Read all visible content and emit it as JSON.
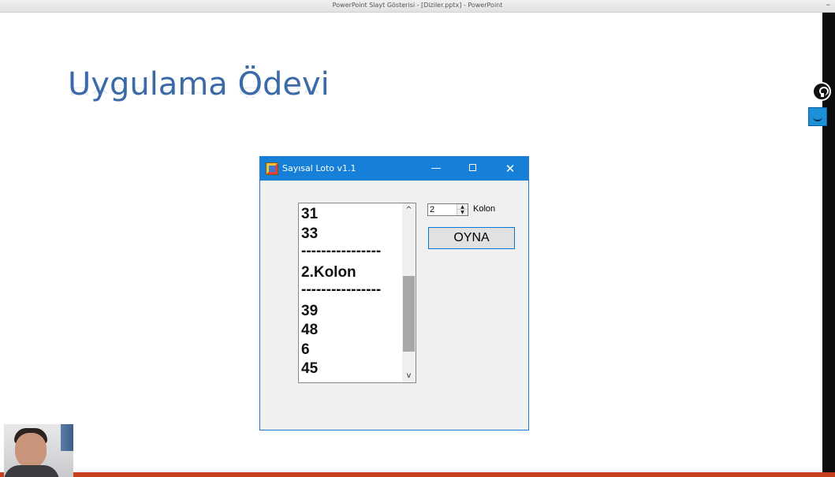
{
  "ppt": {
    "window_title": "PowerPoint Slayt Gösterisi - [Diziler.pptx] - PowerPoint",
    "minimize_glyph": "–",
    "slide_title": "Uygulama Ödevi"
  },
  "app_window": {
    "title": "Sayısal Loto v1.1",
    "minimize_glyph": "—",
    "close_glyph": "✕",
    "listbox": {
      "items": [
        "31",
        "33",
        "----------------",
        "2.Kolon",
        "----------------",
        "39",
        "48",
        "6",
        "45"
      ]
    },
    "scroll_up_glyph": "^",
    "scroll_down_glyph": "v",
    "numeric": {
      "value": "2",
      "up_glyph": "▲",
      "down_glyph": "▼"
    },
    "kolon_label": "Kolon",
    "play_button": "OYNA"
  },
  "icons": {
    "app": "lottery-app-icon",
    "side_top": "lightbulb-icon",
    "side_bottom": "camera-icon"
  },
  "colors": {
    "win_titlebar": "#1680d9",
    "slide_title": "#3a6aa8",
    "bottom_bar": "#c6401c"
  }
}
